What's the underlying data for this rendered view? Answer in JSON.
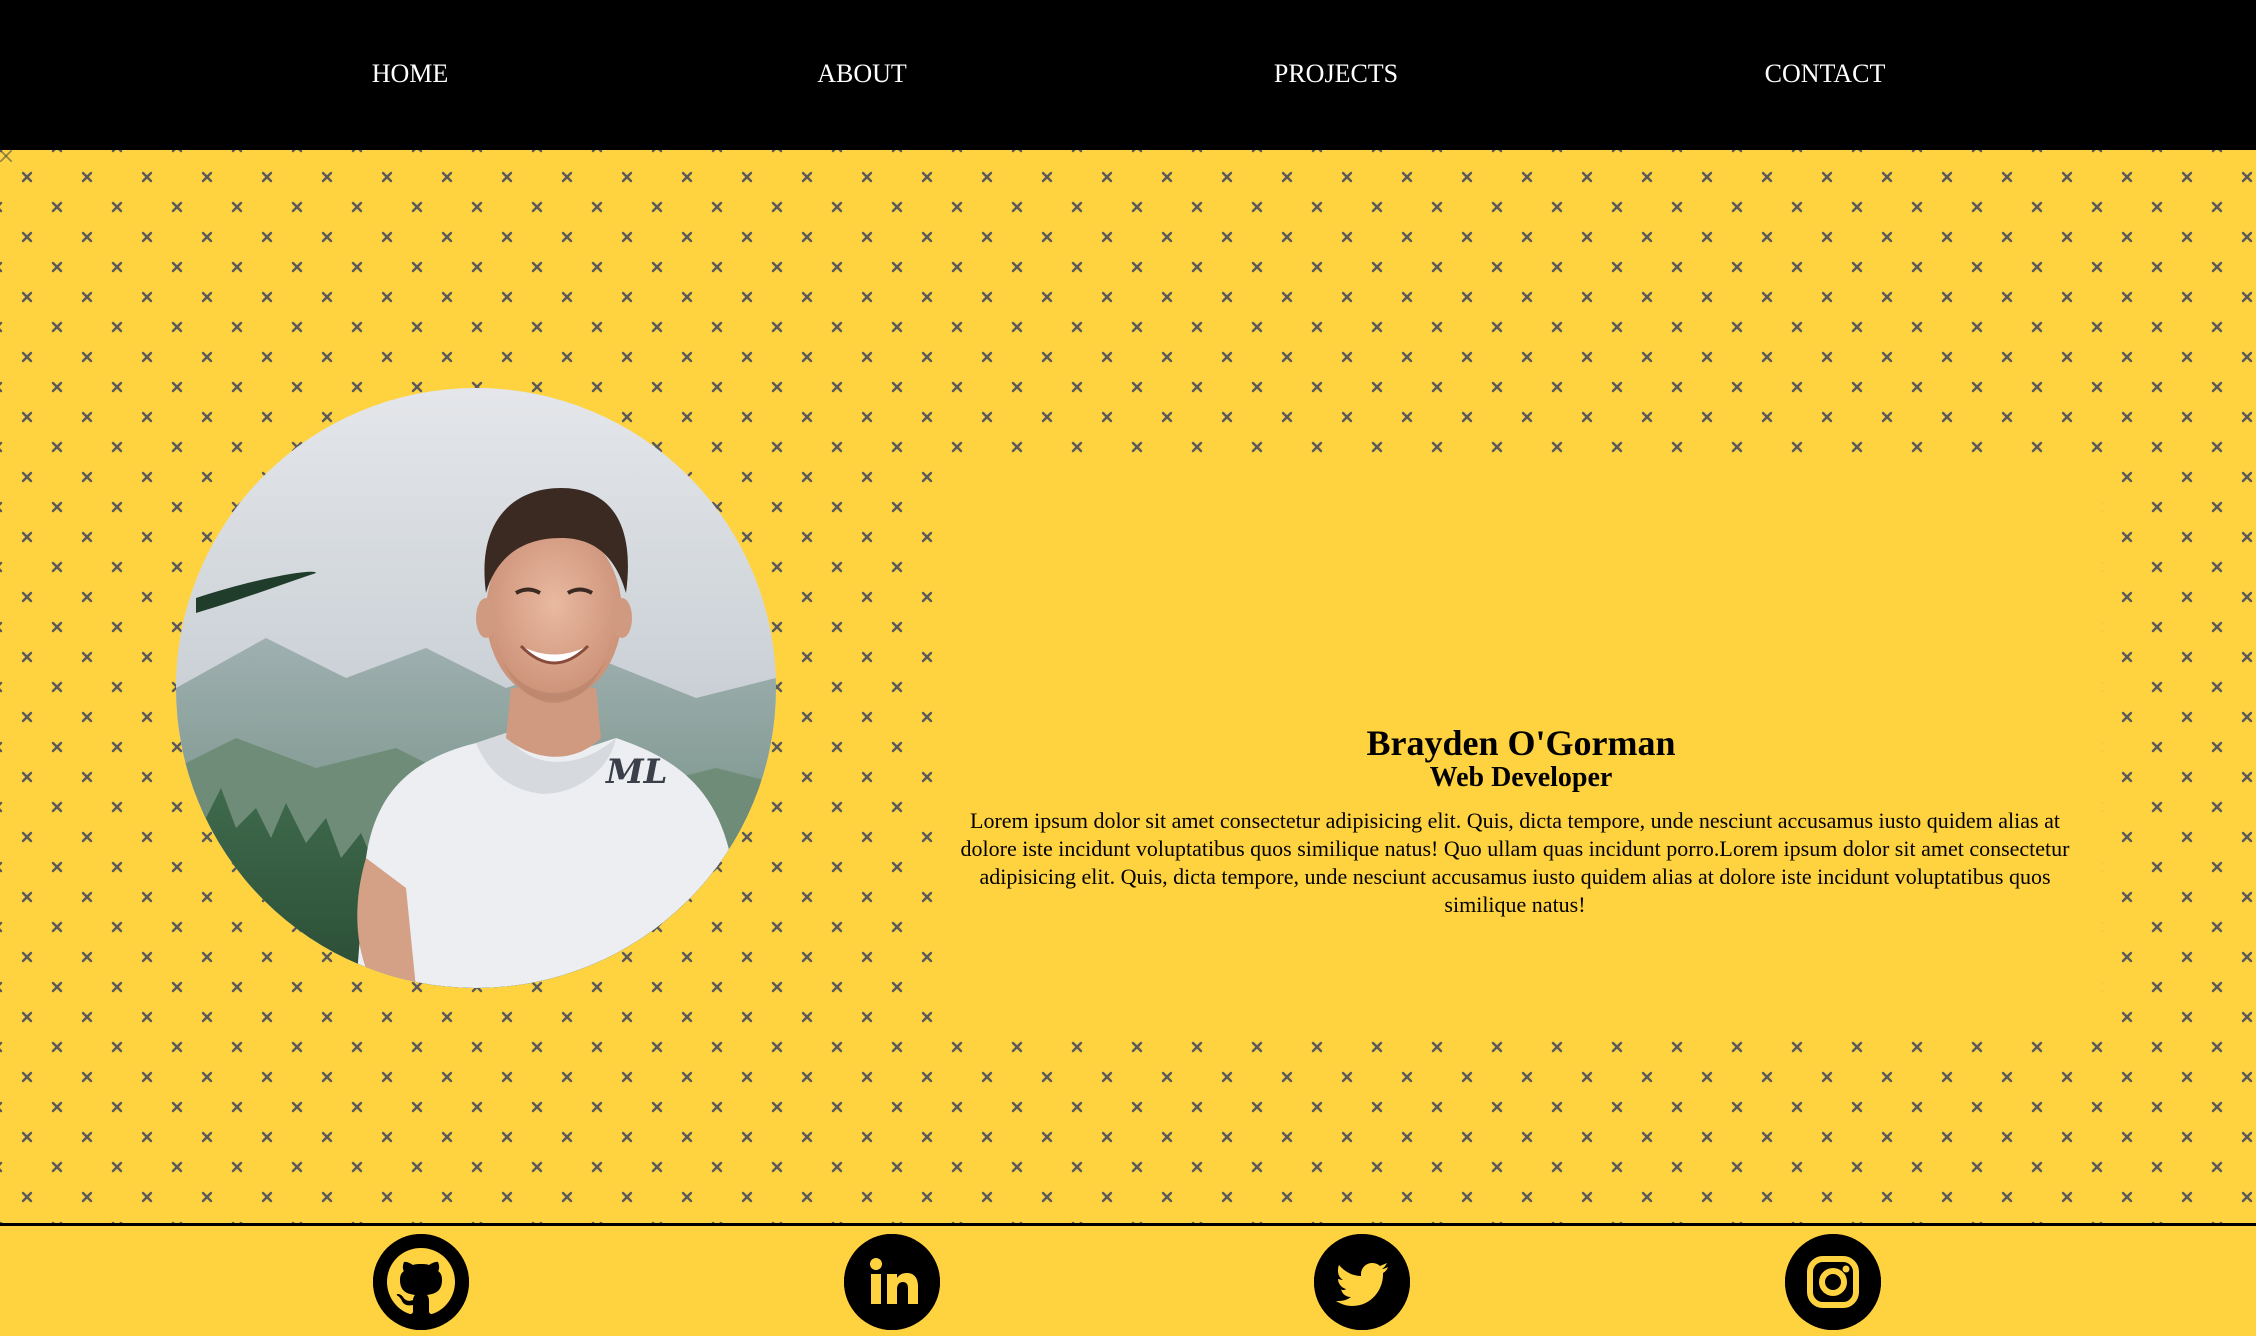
{
  "nav": {
    "home": "HOME",
    "about": "ABOUT",
    "projects": "PROJECTS",
    "contact": "CONTACT"
  },
  "profile": {
    "name": "Brayden O'Gorman",
    "role": "Web Developer",
    "bio": "Lorem ipsum dolor sit amet consectetur adipisicing elit. Quis, dicta tempore, unde nesciunt accusamus iusto quidem alias at dolore iste incidunt voluptatibus quos similique natus! Quo ullam quas incidunt porro.Lorem ipsum dolor sit amet consectetur adipisicing elit. Quis, dicta tempore, unde nesciunt accusamus iusto quidem alias at dolore iste incidunt voluptatibus quos similique natus!",
    "shirt_mark": "ML"
  },
  "social": [
    {
      "name": "github",
      "icon": "github-icon"
    },
    {
      "name": "linkedin",
      "icon": "linkedin-icon"
    },
    {
      "name": "twitter",
      "icon": "twitter-icon"
    },
    {
      "name": "instagram",
      "icon": "instagram-icon"
    }
  ],
  "colors": {
    "accent": "#ffd23f",
    "nav_bg": "#000000",
    "nav_text": "#ffffff",
    "pattern_mark": "#5a5a5a"
  }
}
